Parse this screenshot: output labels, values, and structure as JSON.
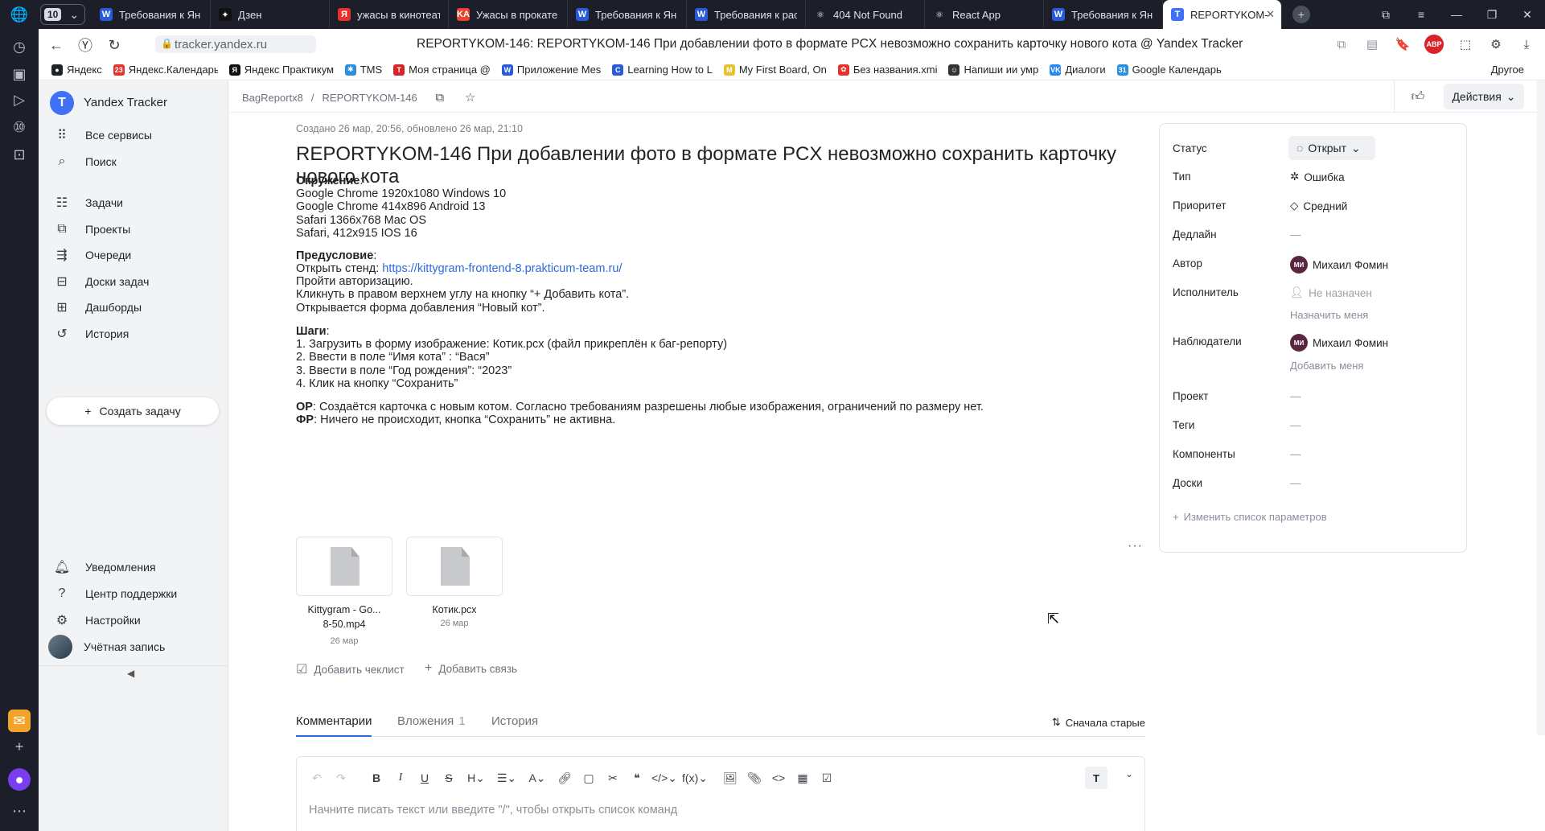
{
  "browser": {
    "tab_counter": "10",
    "tabs": [
      {
        "title": "Требования к Ян",
        "fav": "W",
        "color": "#2b5ad8"
      },
      {
        "title": "Дзен",
        "fav": "✦",
        "color": "#111111"
      },
      {
        "title": "ужасы в кинотеат",
        "fav": "Я",
        "color": "#e5322d"
      },
      {
        "title": "Ужасы в прокате",
        "fav": "KA",
        "color": "#e8432f"
      },
      {
        "title": "Требования к Ян",
        "fav": "W",
        "color": "#2b5ad8"
      },
      {
        "title": "Требования к рас",
        "fav": "W",
        "color": "#2b5ad8"
      },
      {
        "title": "404 Not Found",
        "fav": "⚛",
        "color": "#1c1f2a"
      },
      {
        "title": "React App",
        "fav": "⚛",
        "color": "#1c1f2a"
      },
      {
        "title": "Требования к Ян",
        "fav": "W",
        "color": "#2b5ad8"
      },
      {
        "title": "REPORTYKOM-",
        "fav": "T",
        "color": "#3f70f5"
      }
    ],
    "url": "tracker.yandex.ru",
    "page_title": "REPORTYKOM-146: REPORTYKOM-146 При добавлении фото в формате PCX невозможно сохранить карточку нового кота @ Yandex Tracker",
    "bookmarks": [
      {
        "label": "Яндекс",
        "fav": "●",
        "color": "#1f2226"
      },
      {
        "label": "Яндекс.Календарь",
        "fav": "23",
        "color": "#e5322d"
      },
      {
        "label": "Яндекс Практикум",
        "fav": "Я",
        "color": "#111111"
      },
      {
        "label": "TMS",
        "fav": "✱",
        "color": "#2b8fe0"
      },
      {
        "label": "Моя страница @",
        "fav": "T",
        "color": "#d8232a"
      },
      {
        "label": "Приложение Mes",
        "fav": "W",
        "color": "#2b5ad8"
      },
      {
        "label": "Learning How to L",
        "fav": "C",
        "color": "#2b5ad8"
      },
      {
        "label": "My First Board, On",
        "fav": "M",
        "color": "#e8c22e"
      },
      {
        "label": "Без названия.xmi",
        "fav": "✿",
        "color": "#e5322d"
      },
      {
        "label": "Напиши ии умр",
        "fav": "☺",
        "color": "#333333"
      },
      {
        "label": "Диалоги",
        "fav": "VK",
        "color": "#2787f5"
      },
      {
        "label": "Google Календарь",
        "fav": "31",
        "color": "#2b8fe0"
      }
    ],
    "bookmarks_other": "Другое"
  },
  "nav": {
    "brand": "Yandex Tracker",
    "all_services": "Все сервисы",
    "search": "Поиск",
    "items": [
      {
        "label": "Задачи",
        "icon": "tasks-icon"
      },
      {
        "label": "Проекты",
        "icon": "projects-icon"
      },
      {
        "label": "Очереди",
        "icon": "queues-icon"
      },
      {
        "label": "Доски задач",
        "icon": "boards-icon"
      },
      {
        "label": "Дашборды",
        "icon": "dashboards-icon"
      },
      {
        "label": "История",
        "icon": "history-icon"
      }
    ],
    "create_task": "Создать задачу",
    "notifications": "Уведомления",
    "support": "Центр поддержки",
    "settings": "Настройки",
    "account": "Учётная запись"
  },
  "header": {
    "queue": "BagReportx8",
    "issue_key": "REPORTYKOM-146",
    "actions": "Действия"
  },
  "issue": {
    "meta": "Создано 26 мар, 20:56, обновлено 26 мар, 21:10",
    "title": "REPORTYKOM-146 При добавлении фото в формате PCX невозможно сохранить карточку нового кота",
    "env_label": "Окружение",
    "env_lines": [
      "Google Chrome 1920x1080 Windows 10",
      "Google Chrome 414x896 Android 13",
      "Safari 1366x768 Mac OS",
      "Safari, 412x915 IOS 16"
    ],
    "pre_label": "Предусловие",
    "pre_open": "Открыть стенд: ",
    "pre_link": "https://kittygram-frontend-8.prakticum-team.ru/",
    "pre_lines": [
      "Пройти авторизацию.",
      "Кликнуть в правом верхнем углу на кнопку “+ Добавить кота”.",
      "Открывается форма добавления “Новый кот”."
    ],
    "steps_label": "Шаги",
    "steps": [
      "1. Загрузить в форму изображение: Котик.pcx (файл прикреплён к баг-репорту)",
      "2. Ввести в поле “Имя кота” : “Вася”",
      "3. Ввести в поле “Год рождения”: “2023”",
      "4. Клик на кнопку “Сохранить”"
    ],
    "expected_label": "ОР",
    "expected": ": Создаётся карточка с новым котом. Согласно требованиям разрешены любые изображения, ограничений по размеру нет.",
    "actual_label": "ФР",
    "actual": ": Ничего не происходит, кнопка “Сохранить” не активна.",
    "attachments": [
      {
        "name1": "Kittygram - Go...",
        "name2": "8-50.mp4",
        "date": "26 мар"
      },
      {
        "name1": "Котик.pcx",
        "name2": "",
        "date": "26 мар"
      }
    ],
    "add_checklist": "Добавить чеклист",
    "add_link": "Добавить связь"
  },
  "comments": {
    "tabs": [
      {
        "label": "Комментарии",
        "count": ""
      },
      {
        "label": "Вложения",
        "count": "1"
      },
      {
        "label": "История",
        "count": ""
      }
    ],
    "sort": "Сначала старые",
    "placeholder": "Начните писать текст или введите \"/\", чтобы открыть список команд"
  },
  "params": {
    "status_label": "Статус",
    "status_value": "Открыт",
    "type_label": "Тип",
    "type_value": "Ошибка",
    "priority_label": "Приоритет",
    "priority_value": "Средний",
    "deadline_label": "Дедлайн",
    "deadline_value": "—",
    "author_label": "Автор",
    "author_value": "Михаил Фомин",
    "author_initials": "МИ",
    "assignee_label": "Исполнитель",
    "assignee_value": "Не назначен",
    "assign_me": "Назначить меня",
    "followers_label": "Наблюдатели",
    "followers_value": "Михаил Фомин",
    "add_me": "Добавить меня",
    "project_label": "Проект",
    "project_value": "—",
    "tags_label": "Теги",
    "tags_value": "—",
    "components_label": "Компоненты",
    "components_value": "—",
    "boards_label": "Доски",
    "boards_value": "—",
    "change_params": "Изменить список параметров"
  }
}
